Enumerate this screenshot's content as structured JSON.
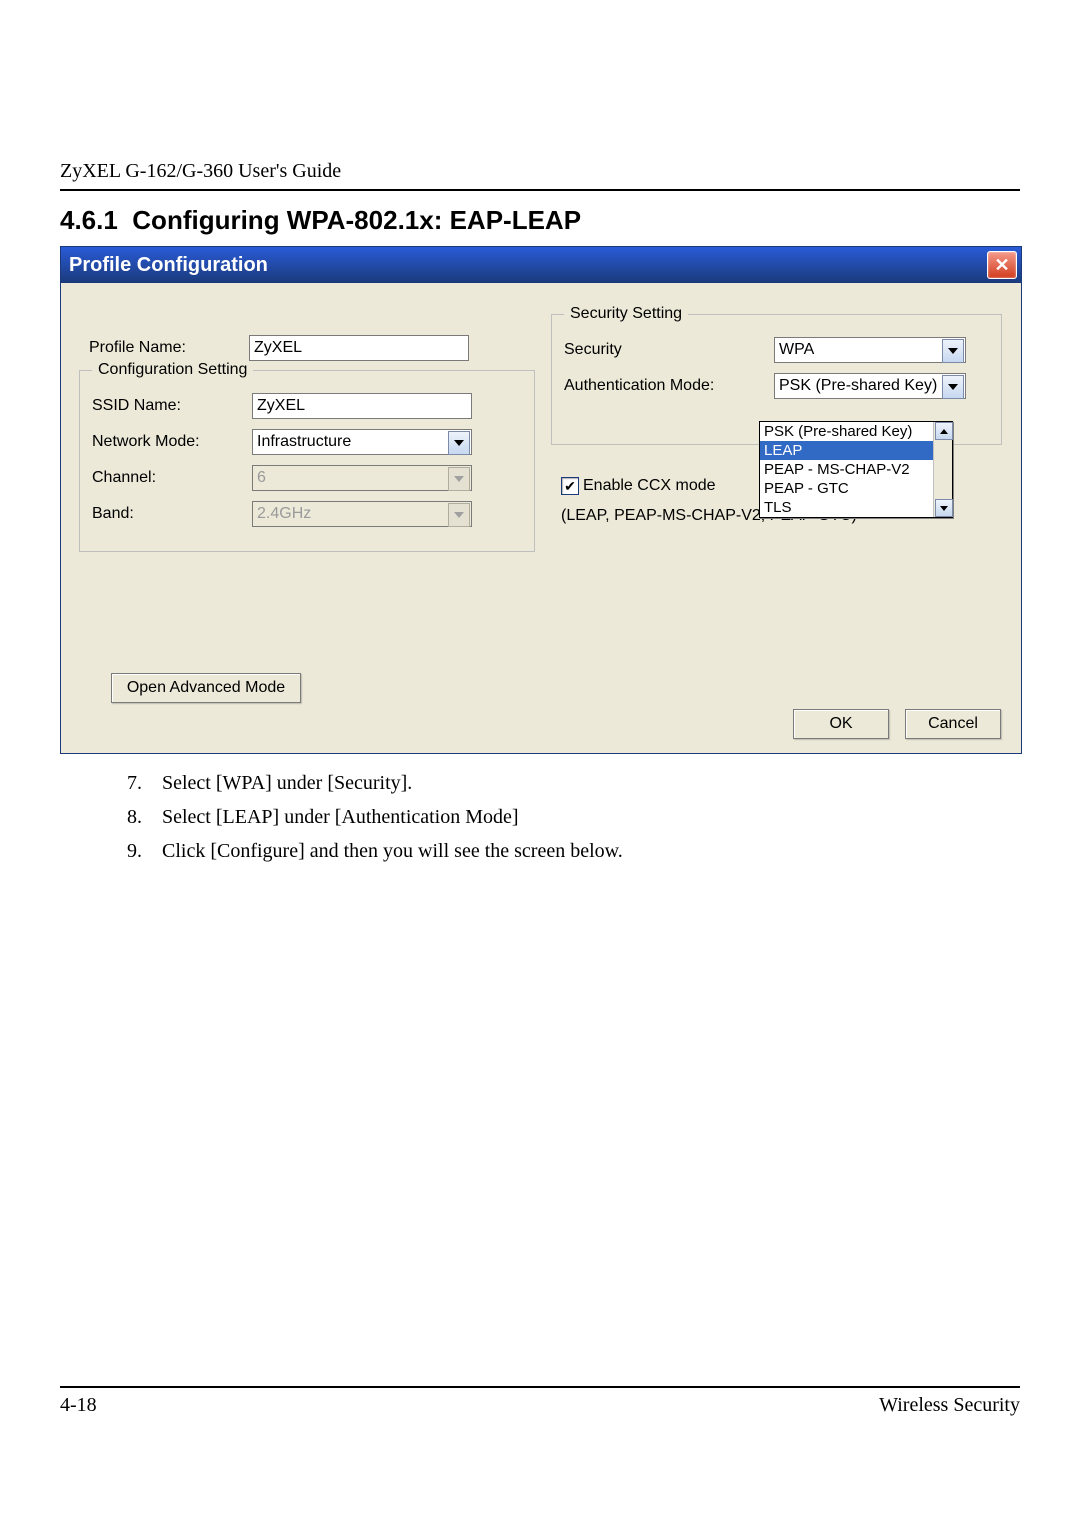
{
  "header": {
    "guide": "ZyXEL G-162/G-360 User's Guide",
    "section_number": "4.6.1",
    "section_title": "Configuring WPA-802.1x: EAP-LEAP"
  },
  "dialog": {
    "title": "Profile Configuration",
    "profile_name_label": "Profile Name:",
    "profile_name_value": "ZyXEL",
    "config_legend": "Configuration Setting",
    "ssid_label": "SSID Name:",
    "ssid_value": "ZyXEL",
    "network_mode_label": "Network Mode:",
    "network_mode_value": "Infrastructure",
    "channel_label": "Channel:",
    "channel_value": "6",
    "band_label": "Band:",
    "band_value": "2.4GHz",
    "security_legend": "Security Setting",
    "security_label": "Security",
    "security_value": "WPA",
    "auth_label": "Authentication Mode:",
    "auth_value": "PSK (Pre-shared Key)",
    "auth_options": {
      "o0": "PSK (Pre-shared Key)",
      "o1": "LEAP",
      "o2": "PEAP - MS-CHAP-V2",
      "o3": "PEAP - GTC",
      "o4": "TLS"
    },
    "ccx_label": "Enable CCX mode",
    "ccx_note": "(LEAP, PEAP-MS-CHAP-V2, PEAP-GTC)",
    "advanced_button": "Open Advanced Mode",
    "ok": "OK",
    "cancel": "Cancel"
  },
  "steps": {
    "s7n": "7.",
    "s7": "Select [WPA] under [Security].",
    "s8n": "8.",
    "s8": "Select [LEAP] under [Authentication Mode]",
    "s9n": "9.",
    "s9": "Click [Configure] and then you will see the screen below."
  },
  "footer": {
    "page_num": "4-18",
    "section": "Wireless Security"
  }
}
